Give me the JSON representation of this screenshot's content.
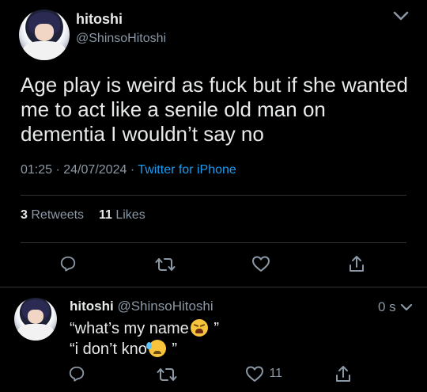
{
  "tweet": {
    "display_name": "hitoshi",
    "handle": "@ShinsoHitoshi",
    "text": "Age play is weird as fuck but if she wanted me to act like a senile old man on dementia I wouldn’t say no",
    "time": "01:25",
    "dot1": "·",
    "date": "24/07/2024",
    "dot2": "·",
    "source": "Twitter for iPhone",
    "retweets_count": "3",
    "retweets_label": "Retweets",
    "likes_count": "11",
    "likes_label": "Likes"
  },
  "reply": {
    "display_name": "hitoshi",
    "handle": "@ShinsoHitoshi",
    "time": "0 s",
    "line1_text": "“what’s my name",
    "line1_end": "”",
    "line2_text": "“i don’t kno",
    "line2_end": "”",
    "like_count": "11"
  },
  "icons": [
    "chevron-down-icon",
    "reply-icon",
    "retweet-icon",
    "like-icon",
    "share-icon",
    "avatar",
    "tired-face-emoji",
    "sad-sweat-face-emoji"
  ],
  "colors": {
    "background": "#000000",
    "text": "#e7e9ea",
    "muted": "#8b98a5",
    "link": "#1d9bf0",
    "divider": "#2f3336"
  }
}
